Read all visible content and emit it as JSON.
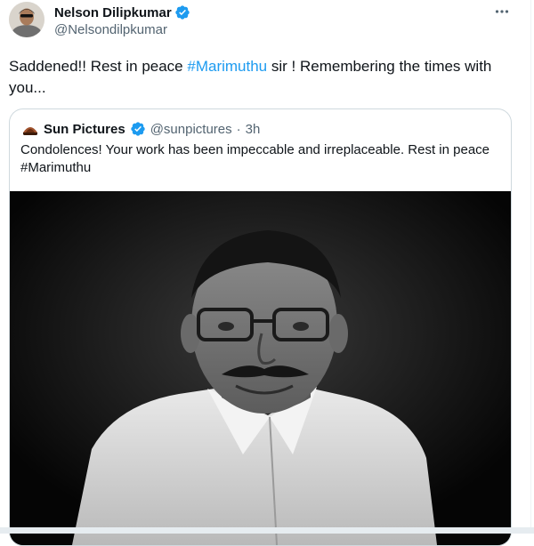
{
  "author": {
    "name": "Nelson Dilipkumar",
    "handle": "@Nelsondilpkumar"
  },
  "tweet": {
    "text_before": "Saddened!! Rest in peace ",
    "hashtag": "#Marimuthu",
    "text_after": " sir ! Remembering the times with you..."
  },
  "quoted": {
    "name": "Sun Pictures",
    "handle": "@sunpictures",
    "separator": "·",
    "time": "3h",
    "text": "Condolences! Your work has been impeccable and irreplaceable. Rest in peace",
    "hashtag": "#Marimuthu"
  },
  "icons": {
    "verified": "verified-badge-icon",
    "more": "more-options-icon"
  },
  "colors": {
    "accent": "#1d9bf0",
    "text": "#0f1419",
    "muted": "#536471",
    "border": "#cfd9de"
  }
}
